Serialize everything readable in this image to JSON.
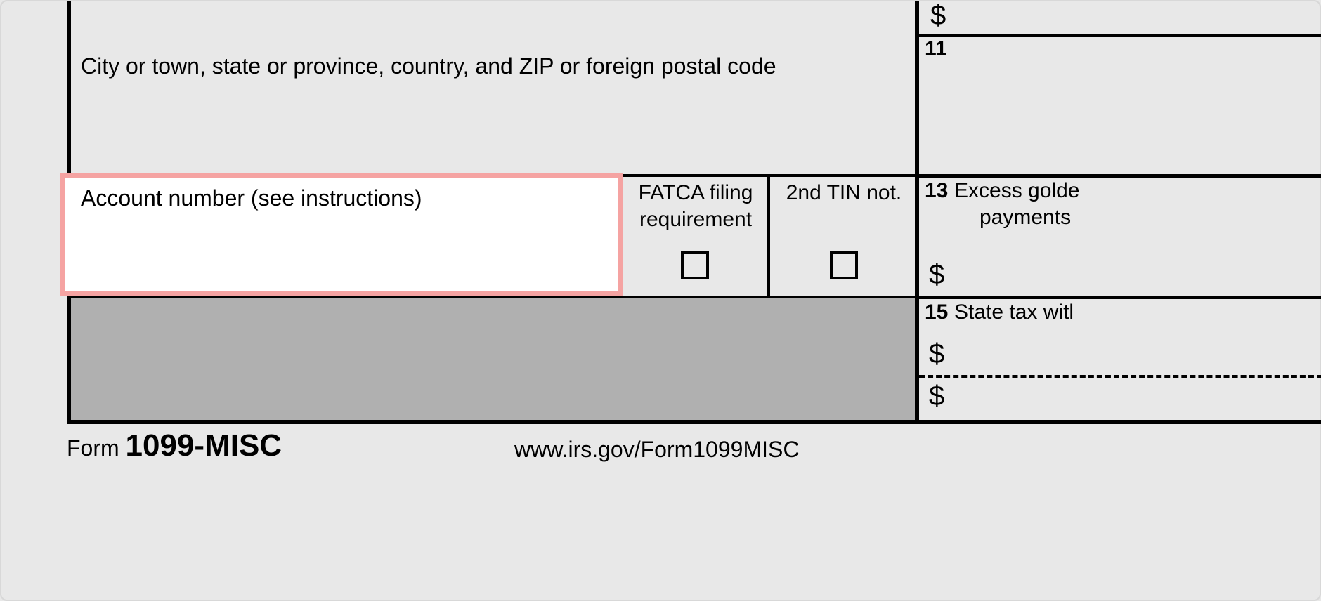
{
  "address_row": {
    "label": "City or town, state or province, country, and ZIP or foreign postal code"
  },
  "top_right_dollar": "$",
  "box11": {
    "number": "11"
  },
  "account": {
    "label": "Account number (see instructions)"
  },
  "fatca": {
    "line1": "FATCA filing",
    "line2": "requirement"
  },
  "tin": {
    "line1": "2nd TIN not."
  },
  "box13": {
    "number": "13",
    "label_line1": "Excess golde",
    "label_line2": "payments",
    "dollar": "$"
  },
  "box15": {
    "number": "15",
    "label": "State tax witl",
    "dollar": "$",
    "dollar2": "$"
  },
  "footer": {
    "form_word": "Form ",
    "form_code": "1099-MISC",
    "url": "www.irs.gov/Form1099MISC"
  }
}
